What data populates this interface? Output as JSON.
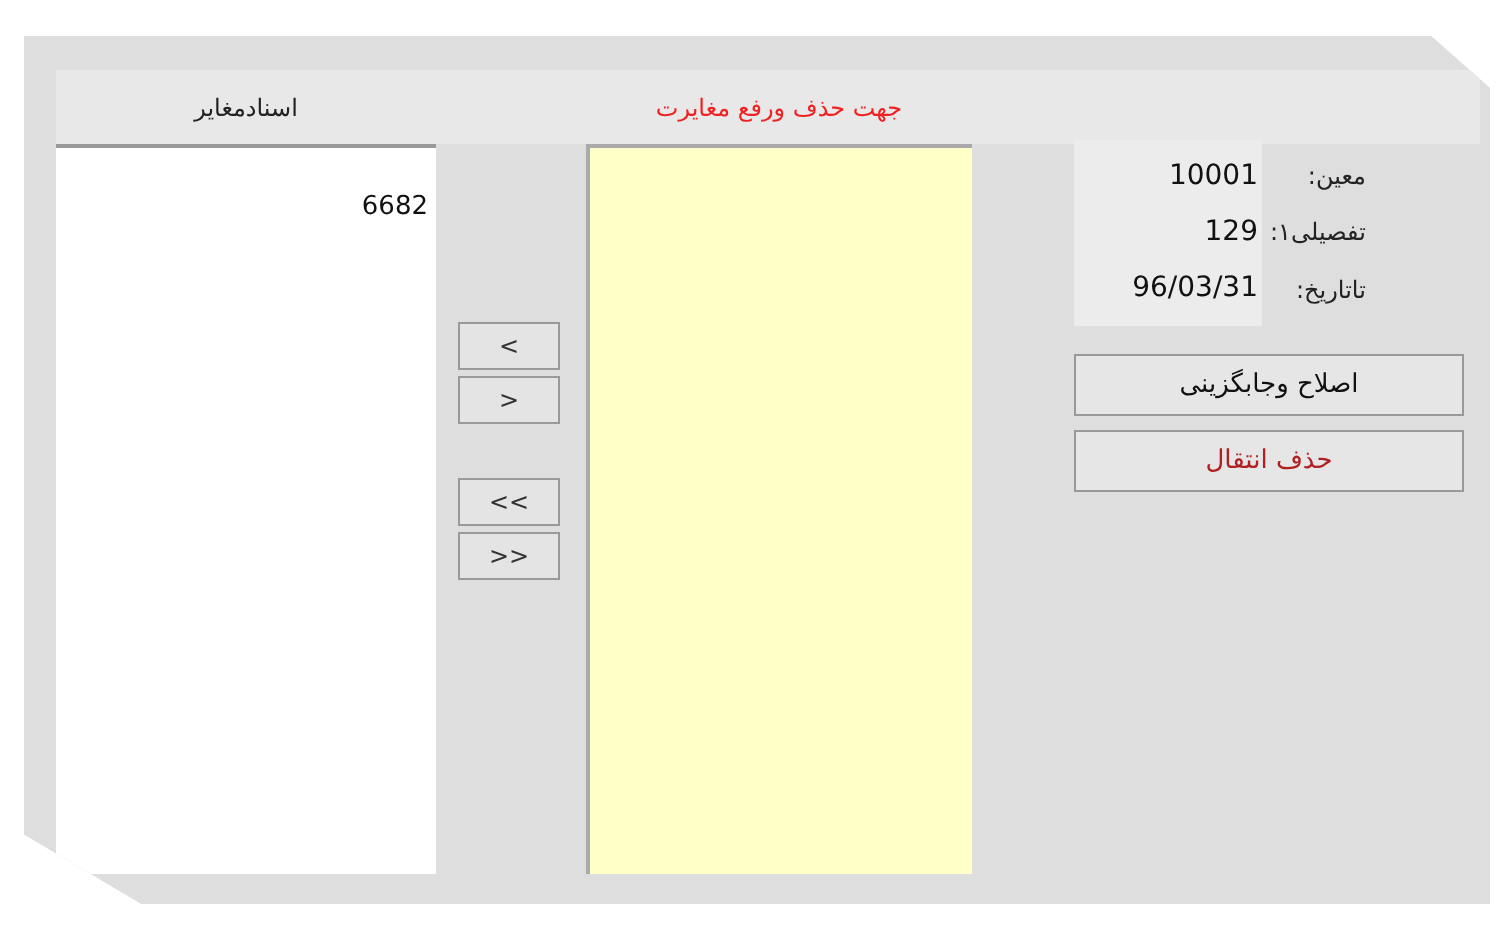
{
  "headers": {
    "mismatched_docs": "اسنادمغایر",
    "delete_title": "جهت حذف ورفع مغایرت"
  },
  "mismatched_list": [
    "6682"
  ],
  "move_buttons": [
    "<",
    ">",
    "<<",
    ">>"
  ],
  "info": [
    {
      "label": "معین:",
      "value": "10001"
    },
    {
      "label": "تفصیلی۱:",
      "value": "129"
    },
    {
      "label": "تاتاریخ:",
      "value": "96/03/31"
    }
  ],
  "actions": [
    {
      "label": "اصلاح وجابگزینی",
      "kind": "normal"
    },
    {
      "label": "حذف انتقال",
      "kind": "danger"
    }
  ]
}
